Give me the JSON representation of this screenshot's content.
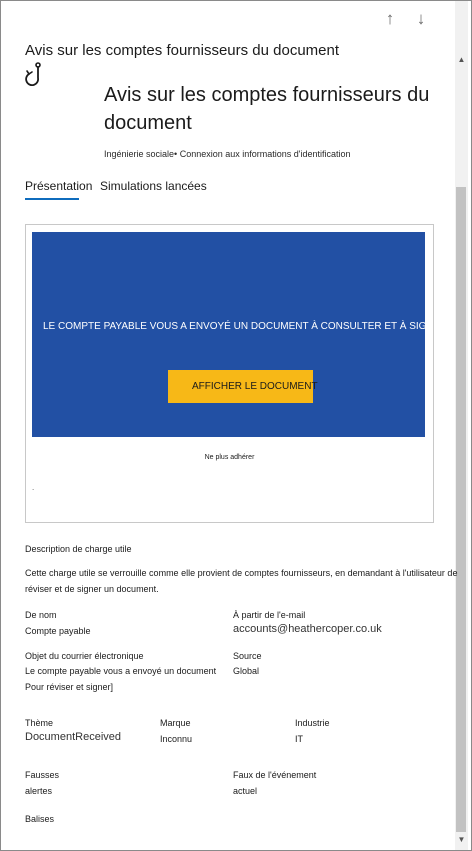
{
  "nav": {
    "prev_icon": "↑",
    "next_icon": "↓"
  },
  "panel": {
    "title": "Avis sur les comptes fournisseurs du document",
    "heading": "Avis sur les comptes fournisseurs du document",
    "subline": "Ingénierie sociale• Connexion aux informations d'identification"
  },
  "tabs": [
    {
      "label": "Présentation",
      "active": true
    },
    {
      "label": "Simulations lancées",
      "active": false
    }
  ],
  "preview": {
    "banner_text": "LE COMPTE PAYABLE VOUS A ENVOYÉ UN DOCUMENT À CONSULTER ET À SIGNER",
    "button_label": "AFFICHER LE DOCUMENT",
    "unsubscribe": "Ne plus adhérer",
    "footer_dot": ".",
    "banner_color": "#2250a4",
    "button_color": "#f7b817"
  },
  "payload": {
    "description_label": "Description de charge utile",
    "description": "Cette charge utile se verrouille comme elle provient de comptes fournisseurs, en demandant à l'utilisateur de réviser et de signer un document."
  },
  "fields": {
    "from_name_label": "De nom",
    "from_name": "Compte payable",
    "from_email_label": "À partir de l'e-mail",
    "from_email": "accounts@heathercoper.co.uk",
    "subject_label": "Objet du courrier électronique",
    "subject_line1": "Le compte payable vous a envoyé un document",
    "subject_line2": "Pour réviser et signer]",
    "source_label": "Source",
    "source": "Global",
    "theme_label": "Thème",
    "theme": "DocumentReceived",
    "brand_label": "Marque",
    "brand": "Inconnu",
    "industry_label": "Industrie",
    "industry": "IT",
    "false_alerts_label": "Fausses",
    "false_alerts_value": "alertes",
    "event_label": "Faux de l'événement",
    "event_value": "actuel",
    "tags_label": "Balises"
  },
  "colors": {
    "accent": "#0f6cbd"
  }
}
